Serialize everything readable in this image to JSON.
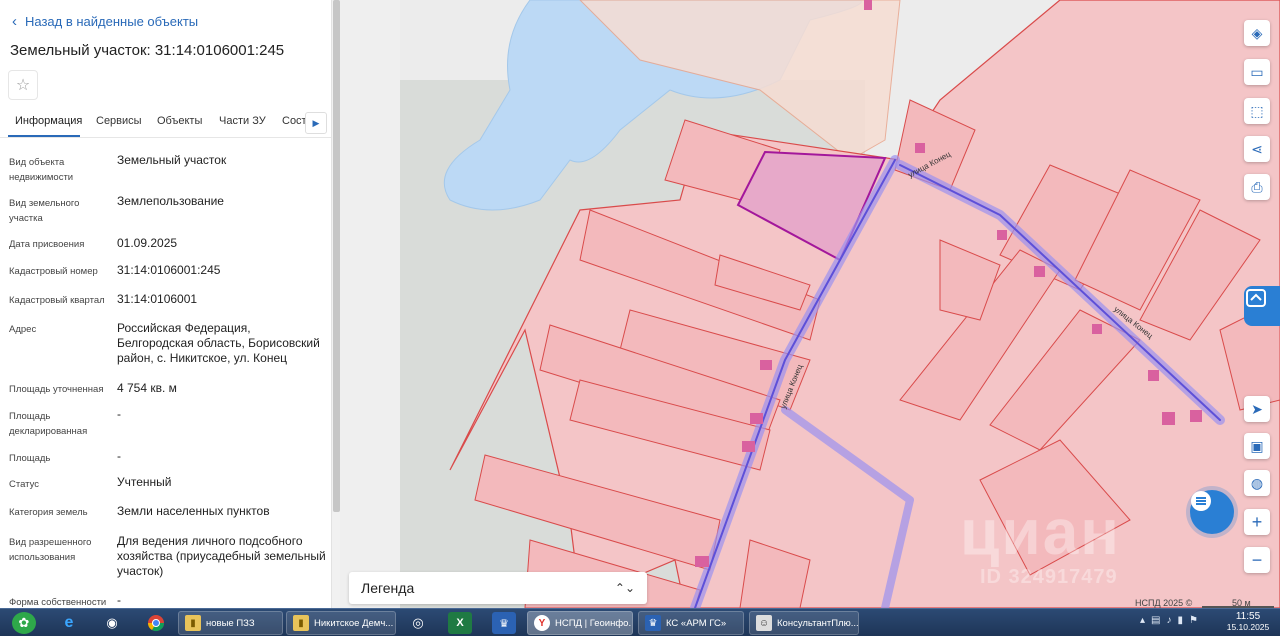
{
  "panel": {
    "back_label": "Назад в найденные объекты",
    "title": "Земельный участок: 31:14:0106001:245",
    "tabs": [
      {
        "label": "Информация"
      },
      {
        "label": "Сервисы"
      },
      {
        "label": "Объекты"
      },
      {
        "label": "Части ЗУ"
      },
      {
        "label": "Соста"
      }
    ],
    "properties": [
      {
        "label": "Вид объекта недвижимости",
        "value": "Земельный участок"
      },
      {
        "label": "Вид земельного участка",
        "value": "Землепользование"
      },
      {
        "label": "Дата присвоения",
        "value": "01.09.2025"
      },
      {
        "label": "Кадастровый номер",
        "value": "31:14:0106001:245"
      },
      {
        "label": "Кадастровый квартал",
        "value": "31:14:0106001"
      },
      {
        "label": "Адрес",
        "value": "Российская Федерация, Белгородская область, Борисовский район, с. Никитское, ул. Конец"
      },
      {
        "label": "Площадь уточненная",
        "value": "4 754 кв. м"
      },
      {
        "label": "Площадь декларированная",
        "value": "-"
      },
      {
        "label": "Площадь",
        "value": "-"
      },
      {
        "label": "Статус",
        "value": "Учтенный"
      },
      {
        "label": "Категория земель",
        "value": "Земли населенных пунктов"
      },
      {
        "label": "Вид разрешенного использования",
        "value": "Для ведения личного подсобного хозяйства (приусадебный земельный участок)"
      },
      {
        "label": "Форма собственности",
        "value": "-"
      }
    ]
  },
  "map": {
    "legend_title": "Легенда",
    "attribution": "НСПД 2025 ©",
    "scale_label": "50 м",
    "watermark": "циан",
    "watermark_id": "ID 324917479",
    "streets": [
      "улица Конец",
      "улица Конец",
      "улица Конец"
    ],
    "icons": [
      "layers-icon",
      "ruler-icon",
      "select-area-icon",
      "share-icon",
      "print-icon",
      "locate-icon",
      "picture-in-picture-icon",
      "geo-pin-icon",
      "zoom-in-icon",
      "zoom-out-icon"
    ],
    "colors": {
      "parcel_fill": "#f4c5c7",
      "parcel_stroke": "#d94b4b",
      "selected_fill": "#e7a9c9",
      "selected_stroke": "#a3179b",
      "road": "#7b6ee8",
      "water": "#bcd9f5"
    }
  },
  "taskbar": {
    "items": [
      {
        "label": "новые ПЗЗ"
      },
      {
        "label": "Никитское Демч..."
      },
      {
        "label": "НСПД | Геоинфо..."
      },
      {
        "label": "КС «АРМ ГС»"
      },
      {
        "label": "КонсультантПлю..."
      }
    ],
    "time": "11:55",
    "date": "15.10.2025"
  }
}
